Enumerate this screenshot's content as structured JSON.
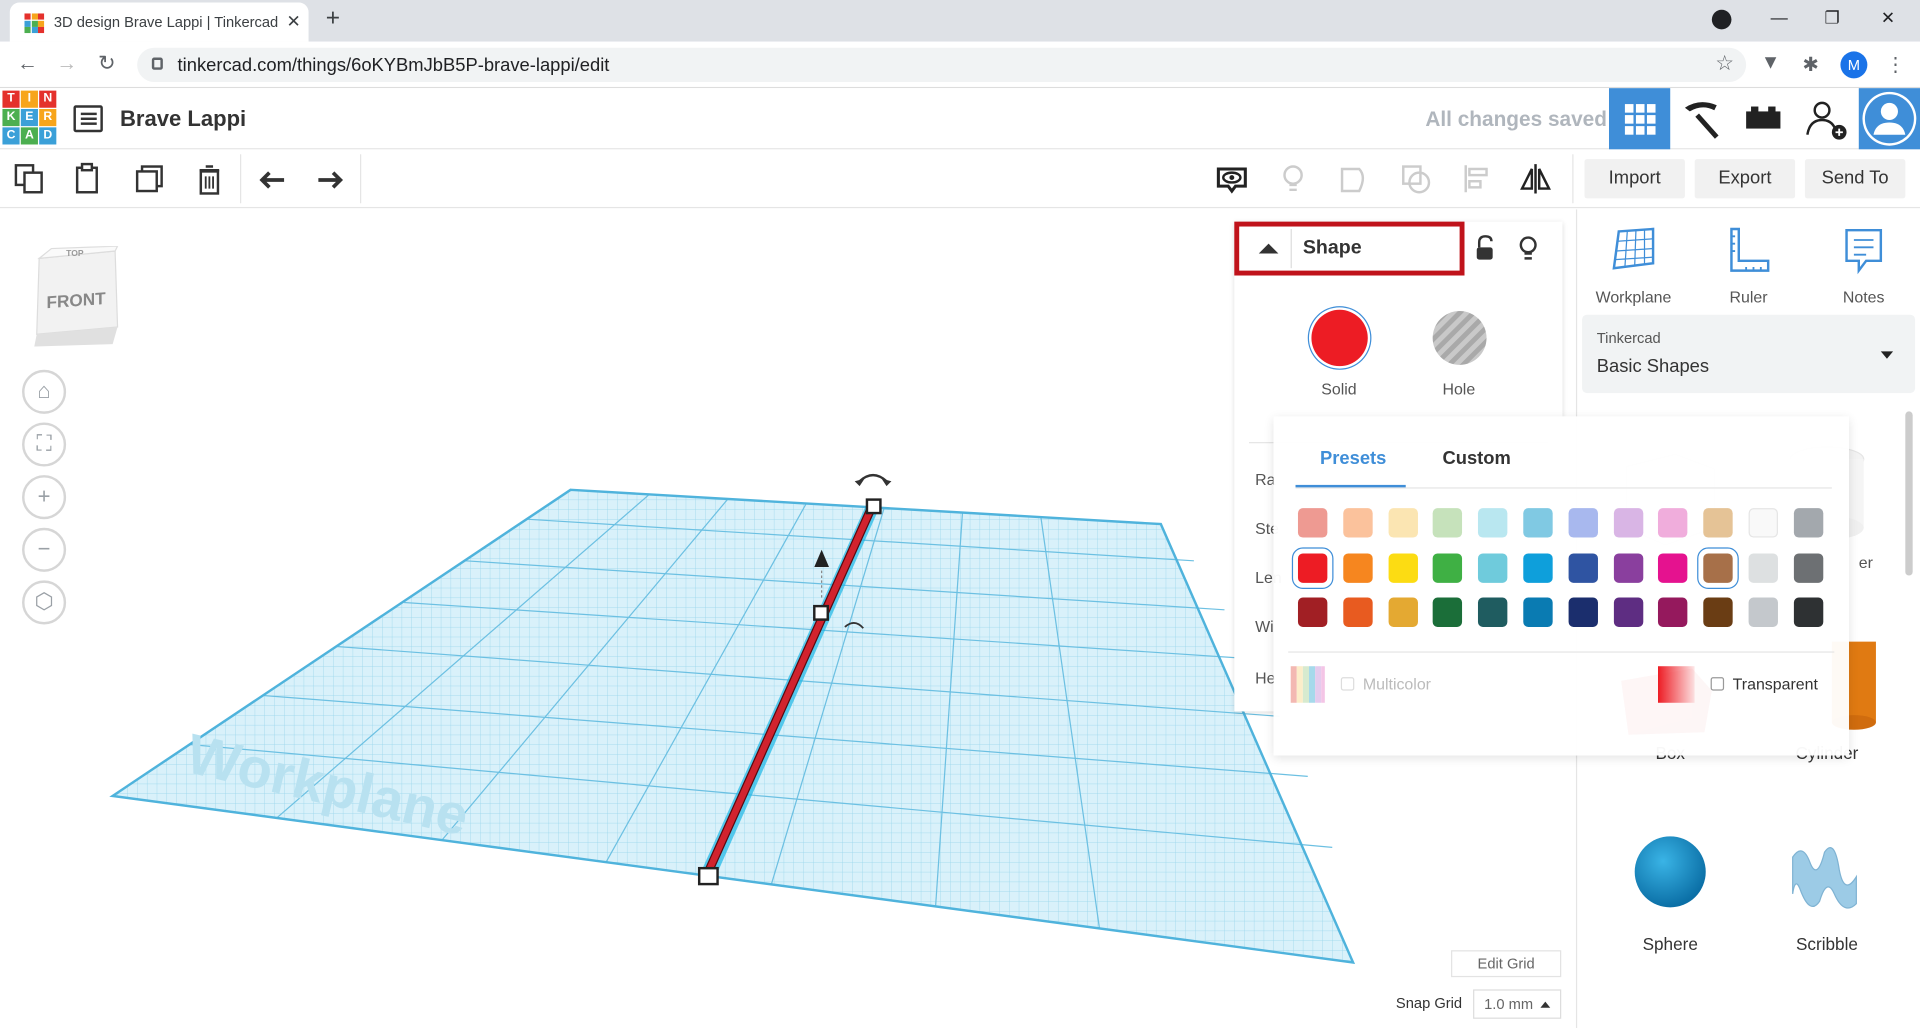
{
  "browser": {
    "tab_title": "3D design Brave Lappi | Tinkercad",
    "url": "tinkercad.com/things/6oKYBmJbB5P-brave-lappi/edit",
    "profile_initial": "M"
  },
  "header": {
    "logo_letters": [
      "T",
      "I",
      "N",
      "K",
      "E",
      "R",
      "C",
      "A",
      "D"
    ],
    "project_name": "Brave Lappi",
    "save_status": "All changes saved"
  },
  "toolbar": {
    "import_label": "Import",
    "export_label": "Export",
    "send_to_label": "Send To"
  },
  "viewcube": {
    "face_label": "FRONT",
    "top_label": "TOP"
  },
  "workplane": {
    "label": "Workplane"
  },
  "inspector": {
    "title": "Shape",
    "solid_label": "Solid",
    "hole_label": "Hole",
    "prop_labels": [
      "Ra",
      "Ste",
      "Len",
      "Wi",
      "He"
    ]
  },
  "color_picker": {
    "tabs": [
      "Presets",
      "Custom"
    ],
    "active_tab": "Presets",
    "selected_color": "#ed1c24",
    "rows": [
      [
        "#ee9a92",
        "#fbc29c",
        "#fbe5b2",
        "#c6e2bb",
        "#b9e7f0",
        "#80c9e3",
        "#a8b8ee",
        "#d9b5e5",
        "#f0addc",
        "#e5c396",
        "#f9f9f9",
        "#a3a8ad"
      ],
      [
        "#ed1c24",
        "#f6861f",
        "#fcdc13",
        "#3fb044",
        "#6fcbdc",
        "#0e9fdb",
        "#2f54a2",
        "#8a3f9e",
        "#e5128f",
        "#a77049",
        "#dde0e1",
        "#6d7073"
      ],
      [
        "#a11f24",
        "#e85b20",
        "#e4a932",
        "#1b6e39",
        "#1f5c60",
        "#0a7bb2",
        "#1b2e6d",
        "#5e2d82",
        "#95195d",
        "#6a3d14",
        "#c4c8cc",
        "#2e3133"
      ]
    ],
    "multicolor_label": "Multicolor",
    "transparent_label": "Transparent"
  },
  "right_panel": {
    "tools": [
      "Workplane",
      "Ruler",
      "Notes"
    ],
    "library_group": "Tinkercad",
    "library_name": "Basic Shapes",
    "shapes": [
      "Box",
      "Cylinder",
      "Sphere",
      "Scribble"
    ],
    "partial_label": "er"
  },
  "grid": {
    "edit_grid_label": "Edit Grid",
    "snap_grid_label": "Snap Grid",
    "snap_value": "1.0 mm"
  }
}
